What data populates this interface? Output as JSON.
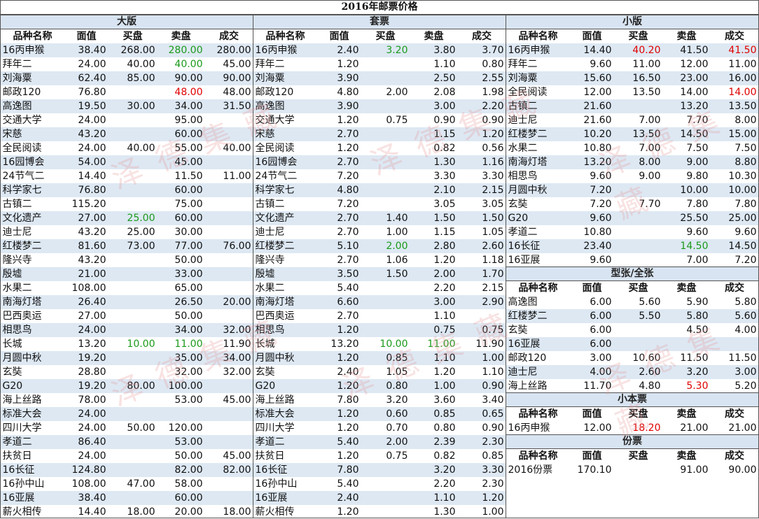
{
  "title": "2016年邮票价格",
  "cols": [
    "品种名称",
    "面值",
    "买盘",
    "卖盘",
    "成交"
  ],
  "cols_small": [
    "品种名称",
    "买盘",
    "卖盘",
    "成交"
  ],
  "watermark": "泽德集藏",
  "colors": {
    "band": "#dde8f3",
    "section": "#d8e4f1",
    "green": "#1a9a1a",
    "red": "#e00000"
  },
  "sections": {
    "daban": {
      "title": "大版",
      "rows": [
        {
          "name": "16丙申猴",
          "face": "38.40",
          "buy": "268.00",
          "sell": "280.00",
          "deal": "280.00",
          "sell_color": "green"
        },
        {
          "name": "拜年二",
          "face": "24.00",
          "buy": "40.00",
          "sell": "40.00",
          "deal": "45.00",
          "sell_color": "green"
        },
        {
          "name": "刘海粟",
          "face": "62.40",
          "buy": "85.00",
          "sell": "90.00",
          "deal": "90.00"
        },
        {
          "name": "邮政120",
          "face": "76.80",
          "buy": "",
          "sell": "48.00",
          "deal": "48.00",
          "sell_color": "red"
        },
        {
          "name": "高逸图",
          "face": "19.50",
          "buy": "30.00",
          "sell": "34.00",
          "deal": "31.50"
        },
        {
          "name": "交通大学",
          "face": "24.00",
          "buy": "",
          "sell": "95.00",
          "deal": ""
        },
        {
          "name": "宋慈",
          "face": "43.20",
          "buy": "",
          "sell": "60.00",
          "deal": ""
        },
        {
          "name": "全民阅读",
          "face": "24.00",
          "buy": "40.00",
          "sell": "55.00",
          "deal": "40.00"
        },
        {
          "name": "16园博会",
          "face": "54.00",
          "buy": "",
          "sell": "45.00",
          "deal": ""
        },
        {
          "name": "24节气二",
          "face": "14.40",
          "buy": "",
          "sell": "11.50",
          "deal": "11.00"
        },
        {
          "name": "科学家七",
          "face": "76.80",
          "buy": "",
          "sell": "60.00",
          "deal": ""
        },
        {
          "name": "古镇二",
          "face": "115.20",
          "buy": "",
          "sell": "75.00",
          "deal": ""
        },
        {
          "name": "文化遗产",
          "face": "27.00",
          "buy": "25.00",
          "sell": "60.00",
          "deal": "",
          "buy_color": "green"
        },
        {
          "name": "迪士尼",
          "face": "43.20",
          "buy": "25.00",
          "sell": "30.00",
          "deal": ""
        },
        {
          "name": "红楼梦二",
          "face": "81.60",
          "buy": "73.00",
          "sell": "77.00",
          "deal": "76.00"
        },
        {
          "name": "隆兴寺",
          "face": "43.20",
          "buy": "",
          "sell": "50.00",
          "deal": ""
        },
        {
          "name": "殷墟",
          "face": "21.00",
          "buy": "",
          "sell": "33.00",
          "deal": ""
        },
        {
          "name": "水果二",
          "face": "108.00",
          "buy": "",
          "sell": "65.00",
          "deal": ""
        },
        {
          "name": "南海灯塔",
          "face": "26.40",
          "buy": "",
          "sell": "26.50",
          "deal": "20.00"
        },
        {
          "name": "巴西奥运",
          "face": "27.00",
          "buy": "",
          "sell": "50.00",
          "deal": ""
        },
        {
          "name": "相思鸟",
          "face": "24.00",
          "buy": "",
          "sell": "34.00",
          "deal": "32.00"
        },
        {
          "name": "长城",
          "face": "13.20",
          "buy": "10.00",
          "sell": "11.00",
          "deal": "11.90",
          "buy_color": "green",
          "sell_color": "green"
        },
        {
          "name": "月圆中秋",
          "face": "19.20",
          "buy": "",
          "sell": "35.00",
          "deal": "34.00"
        },
        {
          "name": "玄奘",
          "face": "28.80",
          "buy": "",
          "sell": "32.00",
          "deal": "32.00"
        },
        {
          "name": "G20",
          "face": "19.20",
          "buy": "80.00",
          "sell": "100.00",
          "deal": ""
        },
        {
          "name": "海上丝路",
          "face": "78.00",
          "buy": "",
          "sell": "53.00",
          "deal": "45.00"
        },
        {
          "name": "标准大会",
          "face": "24.00",
          "buy": "",
          "sell": "",
          "deal": ""
        },
        {
          "name": "四川大学",
          "face": "24.00",
          "buy": "50.00",
          "sell": "120.00",
          "deal": ""
        },
        {
          "name": "孝道二",
          "face": "86.40",
          "buy": "",
          "sell": "53.00",
          "deal": ""
        },
        {
          "name": "扶贫日",
          "face": "24.00",
          "buy": "",
          "sell": "50.00",
          "deal": "45.00"
        },
        {
          "name": "16长征",
          "face": "124.80",
          "buy": "",
          "sell": "82.00",
          "deal": "82.00"
        },
        {
          "name": "16孙中山",
          "face": "108.00",
          "buy": "47.00",
          "sell": "58.00",
          "deal": ""
        },
        {
          "name": "16亚展",
          "face": "38.40",
          "buy": "",
          "sell": "60.00",
          "deal": ""
        },
        {
          "name": "薪火相传",
          "face": "14.40",
          "buy": "18.00",
          "sell": "20.00",
          "deal": "18.00"
        }
      ]
    },
    "taopiao": {
      "title": "套票",
      "rows": [
        {
          "name": "16丙申猴",
          "face": "2.40",
          "buy": "3.20",
          "sell": "3.80",
          "deal": "3.70",
          "buy_color": "green"
        },
        {
          "name": "拜年二",
          "face": "1.20",
          "buy": "",
          "sell": "1.10",
          "deal": "0.80"
        },
        {
          "name": "刘海粟",
          "face": "3.90",
          "buy": "",
          "sell": "2.50",
          "deal": "2.55"
        },
        {
          "name": "邮政120",
          "face": "4.80",
          "buy": "2.00",
          "sell": "2.08",
          "deal": "1.98"
        },
        {
          "name": "高逸图",
          "face": "3.90",
          "buy": "",
          "sell": "3.00",
          "deal": "2.20"
        },
        {
          "name": "交通大学",
          "face": "1.20",
          "buy": "0.75",
          "sell": "0.90",
          "deal": "0.90"
        },
        {
          "name": "宋慈",
          "face": "2.70",
          "buy": "",
          "sell": "1.15",
          "deal": "1.20"
        },
        {
          "name": "全民阅读",
          "face": "1.20",
          "buy": "",
          "sell": "0.82",
          "deal": "0.56"
        },
        {
          "name": "16园博会",
          "face": "2.70",
          "buy": "",
          "sell": "1.30",
          "deal": "1.16"
        },
        {
          "name": "24节气二",
          "face": "7.20",
          "buy": "",
          "sell": "3.30",
          "deal": "3.30"
        },
        {
          "name": "科学家七",
          "face": "4.80",
          "buy": "",
          "sell": "2.10",
          "deal": "2.15"
        },
        {
          "name": "古镇二",
          "face": "7.20",
          "buy": "",
          "sell": "3.05",
          "deal": "3.05"
        },
        {
          "name": "文化遗产",
          "face": "2.70",
          "buy": "1.40",
          "sell": "1.50",
          "deal": "1.50"
        },
        {
          "name": "迪士尼",
          "face": "2.70",
          "buy": "1.00",
          "sell": "1.15",
          "deal": "1.05"
        },
        {
          "name": "红楼梦二",
          "face": "5.10",
          "buy": "2.00",
          "sell": "2.80",
          "deal": "2.60",
          "buy_color": "green"
        },
        {
          "name": "隆兴寺",
          "face": "2.70",
          "buy": "1.06",
          "sell": "1.20",
          "deal": "1.18"
        },
        {
          "name": "殷墟",
          "face": "3.50",
          "buy": "1.50",
          "sell": "2.00",
          "deal": "1.70"
        },
        {
          "name": "水果二",
          "face": "5.40",
          "buy": "",
          "sell": "2.20",
          "deal": "2.15"
        },
        {
          "name": "南海灯塔",
          "face": "6.60",
          "buy": "",
          "sell": "3.00",
          "deal": "2.90"
        },
        {
          "name": "巴西奥运",
          "face": "2.70",
          "buy": "",
          "sell": "1.10",
          "deal": ""
        },
        {
          "name": "相思鸟",
          "face": "1.20",
          "buy": "",
          "sell": "0.75",
          "deal": "0.75"
        },
        {
          "name": "长城",
          "face": "13.20",
          "buy": "10.00",
          "sell": "11.00",
          "deal": "11.90",
          "buy_color": "green",
          "sell_color": "green"
        },
        {
          "name": "月圆中秋",
          "face": "1.20",
          "buy": "0.85",
          "sell": "1.10",
          "deal": "1.00"
        },
        {
          "name": "玄奘",
          "face": "2.40",
          "buy": "1.05",
          "sell": "1.20",
          "deal": "1.10"
        },
        {
          "name": "G20",
          "face": "1.20",
          "buy": "0.80",
          "sell": "1.00",
          "deal": "0.90"
        },
        {
          "name": "海上丝路",
          "face": "7.80",
          "buy": "3.20",
          "sell": "3.60",
          "deal": "3.40"
        },
        {
          "name": "标准大会",
          "face": "1.20",
          "buy": "0.60",
          "sell": "0.85",
          "deal": "0.65"
        },
        {
          "name": "四川大学",
          "face": "1.20",
          "buy": "0.70",
          "sell": "0.80",
          "deal": "0.90"
        },
        {
          "name": "孝道二",
          "face": "5.40",
          "buy": "2.00",
          "sell": "2.39",
          "deal": "2.30"
        },
        {
          "name": "扶贫日",
          "face": "1.20",
          "buy": "0.75",
          "sell": "0.82",
          "deal": "0.85"
        },
        {
          "name": "16长征",
          "face": "7.80",
          "buy": "",
          "sell": "3.20",
          "deal": "3.30"
        },
        {
          "name": "16孙中山",
          "face": "5.40",
          "buy": "",
          "sell": "2.20",
          "deal": "2.30"
        },
        {
          "name": "16亚展",
          "face": "2.40",
          "buy": "",
          "sell": "1.10",
          "deal": "1.20"
        },
        {
          "name": "薪火相传",
          "face": "1.20",
          "buy": "",
          "sell": "1.30",
          "deal": "1.00"
        }
      ]
    },
    "xiaoban": {
      "title": "小版",
      "rows": [
        {
          "name": "16丙申猴",
          "face": "14.40",
          "buy": "40.20",
          "sell": "41.50",
          "deal": "41.50",
          "buy_color": "red",
          "deal_color": "red"
        },
        {
          "name": "拜年二",
          "face": "9.60",
          "buy": "11.00",
          "sell": "12.00",
          "deal": "11.00"
        },
        {
          "name": "刘海粟",
          "face": "15.60",
          "buy": "16.50",
          "sell": "23.00",
          "deal": "16.00"
        },
        {
          "name": "全民阅读",
          "face": "12.00",
          "buy": "13.50",
          "sell": "14.00",
          "deal": "14.00",
          "deal_color": "red"
        },
        {
          "name": "古镇二",
          "face": "21.60",
          "buy": "",
          "sell": "13.20",
          "deal": "13.50"
        },
        {
          "name": "迪士尼",
          "face": "21.60",
          "buy": "7.00",
          "sell": "7.70",
          "deal": "8.00"
        },
        {
          "name": "红楼梦二",
          "face": "10.20",
          "buy": "13.50",
          "sell": "14.50",
          "deal": "15.00"
        },
        {
          "name": "水果二",
          "face": "10.80",
          "buy": "7.00",
          "sell": "7.50",
          "deal": "7.50"
        },
        {
          "name": "南海灯塔",
          "face": "13.20",
          "buy": "8.00",
          "sell": "9.00",
          "deal": "8.80"
        },
        {
          "name": "相思鸟",
          "face": "9.60",
          "buy": "9.00",
          "sell": "9.80",
          "deal": "10.30"
        },
        {
          "name": "月圆中秋",
          "face": "7.20",
          "buy": "",
          "sell": "10.00",
          "deal": "10.00"
        },
        {
          "name": "玄奘",
          "face": "7.20",
          "buy": "7.70",
          "sell": "7.80",
          "deal": "7.80"
        },
        {
          "name": "G20",
          "face": "9.60",
          "buy": "",
          "sell": "25.50",
          "deal": "25.00"
        },
        {
          "name": "孝道二",
          "face": "10.80",
          "buy": "",
          "sell": "9.60",
          "deal": "9.60"
        },
        {
          "name": "16长征",
          "face": "23.40",
          "buy": "",
          "sell": "14.50",
          "deal": "14.50",
          "sell_color": "green"
        },
        {
          "name": "16亚展",
          "face": "9.60",
          "buy": "",
          "sell": "7.00",
          "deal": "7.20"
        }
      ]
    },
    "xingzhang": {
      "title": "型张/全张",
      "rows": [
        {
          "name": "高逸图",
          "face": "6.00",
          "buy": "5.60",
          "sell": "5.90",
          "deal": "5.80"
        },
        {
          "name": "红楼梦二",
          "face": "6.00",
          "buy": "5.50",
          "sell": "5.80",
          "deal": "5.60"
        },
        {
          "name": "玄奘",
          "face": "6.00",
          "buy": "",
          "sell": "4.50",
          "deal": "4.00"
        },
        {
          "name": "16亚展",
          "face": "6.00",
          "buy": "",
          "sell": "",
          "deal": ""
        },
        {
          "name": "邮政120",
          "face": "3.00",
          "buy": "10.60",
          "sell": "11.50",
          "deal": "11.50"
        },
        {
          "name": "迪士尼",
          "face": "4.00",
          "buy": "2.60",
          "sell": "3.20",
          "deal": "3.00"
        },
        {
          "name": "海上丝路",
          "face": "11.70",
          "buy": "4.80",
          "sell": "5.30",
          "deal": "5.20",
          "sell_color": "red"
        }
      ]
    },
    "xiaobenpiao": {
      "title": "小本票",
      "rows": [
        {
          "name": "16丙申猴",
          "face": "12.00",
          "buy": "18.20",
          "sell": "21.00",
          "deal": "21.00",
          "buy_color": "red"
        }
      ]
    },
    "fenpiao": {
      "title": "份票",
      "rows": [
        {
          "name": "2016份票",
          "face": "170.10",
          "buy": "",
          "sell": "91.00",
          "deal": "90.00"
        }
      ]
    }
  }
}
